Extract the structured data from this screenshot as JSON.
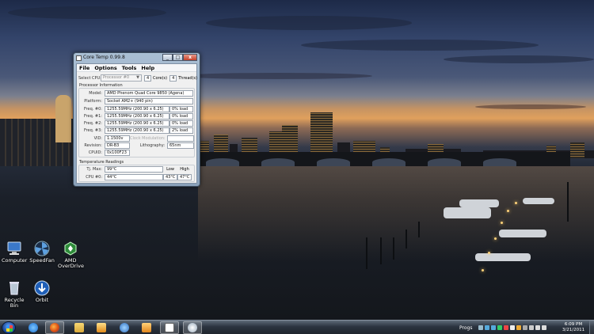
{
  "window": {
    "title": "Core Temp 0.99.8",
    "minimize": "_",
    "maximize": "□",
    "close": "x",
    "menu": [
      "File",
      "Options",
      "Tools",
      "Help"
    ],
    "select_cpu_label": "Select CPU:",
    "select_cpu_value": "Processor #0",
    "cores_count": "4",
    "cores_label": "Core(s)",
    "threads_count": "4",
    "threads_label": "Thread(s)",
    "processor_info_title": "Processor Information",
    "model_label": "Model:",
    "model_value": "AMD Phenom Quad Core 9850 (Agena)",
    "platform_label": "Platform:",
    "platform_value": "Socket AM2+ (940 pin)",
    "freqs": [
      {
        "label": "Freq. #0:",
        "value": "1255.59MHz (200.90 x 6.25)",
        "load": "0% load"
      },
      {
        "label": "Freq. #1:",
        "value": "1255.59MHz (200.90 x 6.25)",
        "load": "0% load"
      },
      {
        "label": "Freq. #2:",
        "value": "1255.59MHz (200.90 x 6.25)",
        "load": "0% load"
      },
      {
        "label": "Freq. #3:",
        "value": "1255.59MHz (200.90 x 6.25)",
        "load": "2% load"
      }
    ],
    "vid_label": "VID:",
    "vid_value": "1.1500v",
    "clock_mod_label": "Clock Modulation:",
    "revision_label": "Revision:",
    "revision_value": "DR-B3",
    "lithography_label": "Lithography:",
    "lithography_value": "65nm",
    "cpuid_label": "CPUID:",
    "cpuid_value": "0x100F23",
    "temp_title": "Temperature Readings",
    "tj_label": "Tj. Max:",
    "tj_value": "99°C",
    "low_label": "Low",
    "high_label": "High",
    "cpu0_label": "CPU #0:",
    "cpu0_value": "44°C",
    "cpu0_low": "43°C",
    "cpu0_high": "47°C"
  },
  "desktop_icons": [
    {
      "label": "Computer",
      "icon": "computer-icon"
    },
    {
      "label": "SpeedFan",
      "icon": "speedfan-icon"
    },
    {
      "label": "AMD OverDrive",
      "icon": "amd-overdrive-icon"
    },
    {
      "label": "Recycle Bin",
      "icon": "recycle-bin-icon"
    },
    {
      "label": "Orbit",
      "icon": "orbit-icon"
    }
  ],
  "taskbar": {
    "pinned": [
      "internet-explorer-icon",
      "firefox-icon",
      "folder-icon",
      "media-player-icon",
      "itunes-icon",
      "outlook-icon",
      "core-temp-icon",
      "paint-icon"
    ],
    "tray_label": "Progs",
    "time": "6:09 PM",
    "date": "3/21/2011"
  },
  "colors": {
    "taskbar": "#2c3440",
    "window_frame": "#a9bed3",
    "close_button": "#c7412a"
  }
}
